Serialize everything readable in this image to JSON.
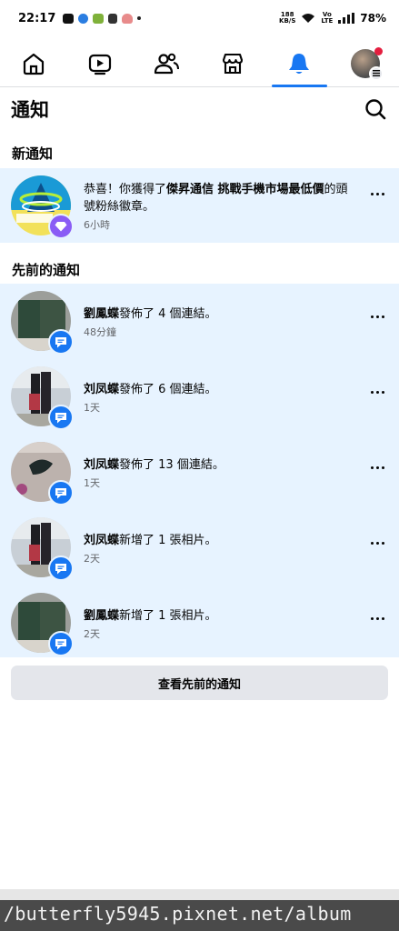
{
  "status_bar": {
    "time": "22:17",
    "speed_top": "188",
    "speed_bottom": "KB/S",
    "volte_top": "Vo",
    "volte_bottom": "LTE",
    "battery": "78%"
  },
  "nav": {
    "items": [
      {
        "name": "home",
        "icon": "home-icon"
      },
      {
        "name": "watch",
        "icon": "video-icon"
      },
      {
        "name": "friends",
        "icon": "friends-icon"
      },
      {
        "name": "marketplace",
        "icon": "store-icon"
      },
      {
        "name": "notifications",
        "icon": "bell-icon",
        "active": true
      },
      {
        "name": "profile",
        "icon": "avatar"
      }
    ],
    "accent": "#1877f2"
  },
  "header": {
    "title": "通知"
  },
  "new_section": {
    "title": "新通知",
    "items": [
      {
        "text_before": "恭喜！你獲得了",
        "bold": "傑昇通信 挑戰手機市場最低價",
        "text_after": "的頭號粉絲徽章。",
        "time": "6小時",
        "badge_icon": "diamond-icon",
        "badge_color": "#8a5cf5"
      }
    ]
  },
  "earlier_section": {
    "title": "先前的通知",
    "items": [
      {
        "name": "劉鳳蝶",
        "action": "發佈了 4 個連結。",
        "time": "48分鐘",
        "badge_icon": "message-icon"
      },
      {
        "name": "刘凤蝶",
        "action": "發佈了 6 個連結。",
        "time": "1天",
        "badge_icon": "message-icon"
      },
      {
        "name": "刘凤蝶",
        "action": "發佈了 13 個連結。",
        "time": "1天",
        "badge_icon": "message-icon"
      },
      {
        "name": "刘凤蝶",
        "action": "新增了 1 張相片。",
        "time": "2天",
        "badge_icon": "message-icon"
      },
      {
        "name": "劉鳳蝶",
        "action": "新增了 1 張相片。",
        "time": "2天",
        "badge_icon": "message-icon"
      }
    ]
  },
  "see_previous_label": "查看先前的通知",
  "watermark": "/butterfly5945.pixnet.net/album",
  "colors": {
    "unread_bg": "#e7f3ff",
    "badge_blue": "#1877f2",
    "secondary_text": "#65676b"
  }
}
